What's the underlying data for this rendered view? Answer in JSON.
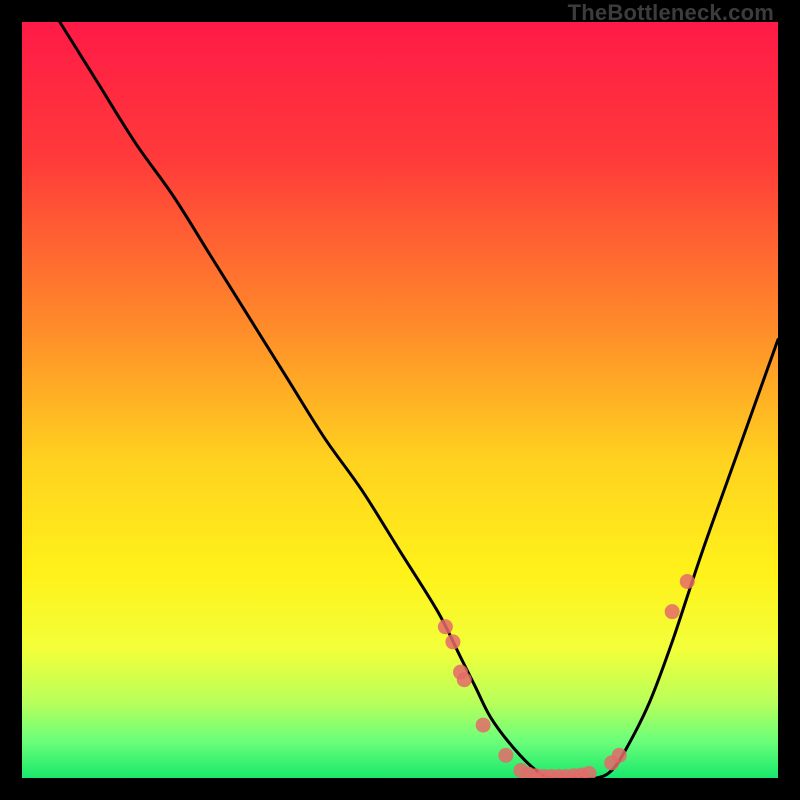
{
  "watermark": "TheBottleneck.com",
  "chart_data": {
    "type": "line",
    "title": "",
    "xlabel": "",
    "ylabel": "",
    "xlim": [
      0,
      100
    ],
    "ylim": [
      0,
      100
    ],
    "gradient_stops": [
      {
        "offset": 0,
        "color": "#ff1a47"
      },
      {
        "offset": 18,
        "color": "#ff3a3a"
      },
      {
        "offset": 40,
        "color": "#ff8a2a"
      },
      {
        "offset": 58,
        "color": "#ffd21f"
      },
      {
        "offset": 73,
        "color": "#fff21a"
      },
      {
        "offset": 83,
        "color": "#f2ff3a"
      },
      {
        "offset": 90,
        "color": "#b8ff5a"
      },
      {
        "offset": 95,
        "color": "#6dff7a"
      },
      {
        "offset": 100,
        "color": "#19e86b"
      }
    ],
    "series": [
      {
        "name": "bottleneck-curve",
        "x": [
          5,
          10,
          15,
          20,
          25,
          30,
          35,
          40,
          45,
          50,
          55,
          58,
          60,
          62,
          65,
          68,
          70,
          73,
          76,
          78,
          80,
          83,
          86,
          90,
          95,
          100
        ],
        "y": [
          100,
          92,
          84,
          77,
          69,
          61,
          53,
          45,
          38,
          30,
          22,
          16,
          12,
          8,
          4,
          1,
          0,
          0,
          0,
          1,
          4,
          10,
          18,
          30,
          44,
          58
        ]
      }
    ],
    "markers": {
      "name": "highlight-points",
      "x": [
        56,
        57,
        58,
        58.5,
        61,
        64,
        66,
        67,
        68,
        69,
        70,
        71,
        72,
        73,
        74,
        75,
        78,
        79,
        86,
        88
      ],
      "y": [
        20,
        18,
        14,
        13,
        7,
        3,
        1,
        0.5,
        0.3,
        0.2,
        0.2,
        0.2,
        0.2,
        0.3,
        0.4,
        0.6,
        2,
        3,
        22,
        26
      ]
    }
  }
}
